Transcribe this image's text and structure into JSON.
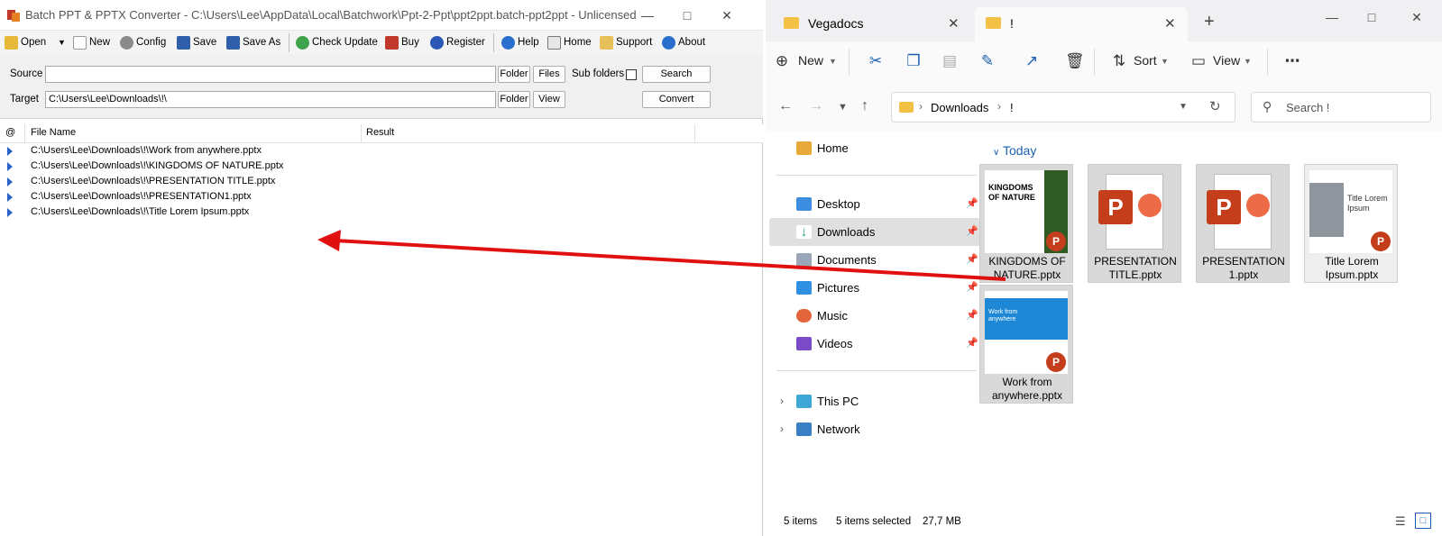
{
  "converter": {
    "title": "Batch PPT & PPTX Converter - C:\\Users\\Lee\\AppData\\Local\\Batchwork\\Ppt-2-Ppt\\ppt2ppt.batch-ppt2ppt - Unlicensed",
    "toolbar": {
      "open": "Open",
      "new": "New",
      "config": "Config",
      "save": "Save",
      "save_as": "Save As",
      "check_update": "Check Update",
      "buy": "Buy",
      "register": "Register",
      "help": "Help",
      "home": "Home",
      "support": "Support",
      "about": "About"
    },
    "form": {
      "source_label": "Source",
      "source_value": "",
      "target_label": "Target",
      "target_value": "C:\\Users\\Lee\\Downloads\\!\\",
      "folder_btn": "Folder",
      "files_btn": "Files",
      "subfolders_label": "Sub folders",
      "search_btn": "Search",
      "view_btn": "View",
      "convert_btn": "Convert"
    },
    "list": {
      "col_at": "@",
      "col_file": "File Name",
      "col_result": "Result",
      "rows": [
        "C:\\Users\\Lee\\Downloads\\!\\Work from anywhere.pptx",
        "C:\\Users\\Lee\\Downloads\\!\\KINGDOMS OF NATURE.pptx",
        "C:\\Users\\Lee\\Downloads\\!\\PRESENTATION TITLE.pptx",
        "C:\\Users\\Lee\\Downloads\\!\\PRESENTATION1.pptx",
        "C:\\Users\\Lee\\Downloads\\!\\Title Lorem Ipsum.pptx"
      ]
    }
  },
  "explorer": {
    "tabs": [
      "Vegadocs",
      "!"
    ],
    "commands": {
      "new": "New",
      "sort": "Sort",
      "view": "View"
    },
    "address": {
      "crumbs": [
        "Downloads",
        "!"
      ],
      "search_placeholder": "Search !"
    },
    "nav": {
      "home": "Home",
      "desktop": "Desktop",
      "downloads": "Downloads",
      "documents": "Documents",
      "pictures": "Pictures",
      "music": "Music",
      "videos": "Videos",
      "this_pc": "This PC",
      "network": "Network"
    },
    "group": "Today",
    "files": [
      {
        "name": "KINGDOMS OF NATURE.pptx",
        "thumb_text": "KINGDOMS OF NATURE"
      },
      {
        "name": "PRESENTATION TITLE.pptx"
      },
      {
        "name": "PRESENTATION 1.pptx"
      },
      {
        "name": "Title Lorem Ipsum.pptx",
        "thumb_text": "Title Lorem Ipsum"
      },
      {
        "name": "Work from anywhere.pptx",
        "thumb_text": "Work from anywhere"
      }
    ],
    "status": {
      "count": "5 items",
      "selected": "5 items selected",
      "size": "27,7 MB"
    }
  },
  "colors": {
    "arrow": "#e01010",
    "accent": "#1a5fb4",
    "powerpoint": "#c43e1c"
  }
}
